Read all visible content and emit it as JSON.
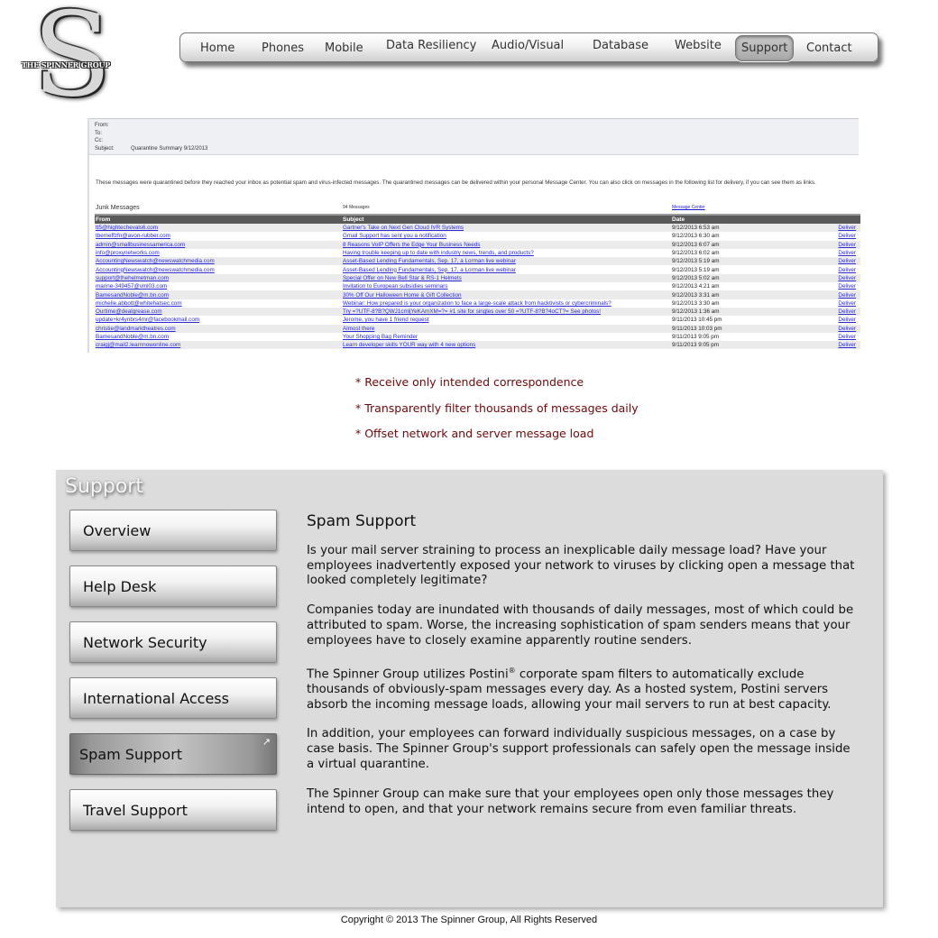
{
  "logo": {
    "letter": "S",
    "brand_text": "THE SPINNER GROUP"
  },
  "nav": {
    "items": [
      {
        "label": "Home",
        "active": false
      },
      {
        "label": "Phones",
        "active": false
      },
      {
        "label": "Mobile",
        "active": false
      },
      {
        "label": "Data Resiliency",
        "active": false
      },
      {
        "label": "Audio/Visual",
        "active": false
      },
      {
        "label": "Database",
        "active": false
      },
      {
        "label": "Website",
        "active": false
      },
      {
        "label": "Support",
        "active": true
      },
      {
        "label": "Contact",
        "active": false
      }
    ]
  },
  "email": {
    "header": {
      "from_label": "From:",
      "from_value": "",
      "to_label": "To:",
      "cc_label": "Cc:",
      "subject_label": "Subject:",
      "subject_value": "Quarantine Summary 9/12/2013"
    },
    "intro": "These messages were quarantined before they reached your inbox as potential spam and virus-infected messages. The quarantined messages can be delivered within your personal Message Center. You can also click on messages in the following list for delivery, if you can see them as links.",
    "junk_title": "Junk Messages",
    "message_count": "94 Messages",
    "message_center_link": "Message Center",
    "columns": [
      "From",
      "Subject",
      "Date",
      ""
    ],
    "deliver_label": "Deliver",
    "rows": [
      {
        "from": "tt5@hightechevals6.com",
        "subject": "Gartner's Take on Next Gen Cloud IVR Systems",
        "date": "9/12/2013 6:53 am"
      },
      {
        "from": "tbemeffzfn@avon-rubber.com",
        "subject": "Gmail Support has sent you a notification",
        "date": "9/12/2013 6:30 am"
      },
      {
        "from": "admin@smallbusinessamerica.com",
        "subject": "8 Reasons VoIP Offers the Edge Your Business Needs",
        "date": "9/12/2013 6:07 am"
      },
      {
        "from": "info@proxynetworks.com",
        "subject": "Having trouble keeping up to date with industry news, trends, and products?",
        "date": "9/12/2013 6:02 am"
      },
      {
        "from": "AccountingNewswatch@newswatchmedia.com",
        "subject": "Asset-Based Lending Fundamentals, Sep. 17, a Lorman live webinar",
        "date": "9/12/2013 5:19 am"
      },
      {
        "from": "AccountingNewswatch@newswatchmedia.com",
        "subject": "Asset-Based Lending Fundamentals, Sep. 17, a Lorman live webinar",
        "date": "9/12/2013 5:19 am"
      },
      {
        "from": "support@thehelmetman.com",
        "subject": "Special Offer on New Bell Star & RS-1 Helmets",
        "date": "9/12/2013 5:02 am"
      },
      {
        "from": "marine-349457@vml03.com",
        "subject": "Invitation to European subsidies seminars",
        "date": "9/12/2013 4:21 am"
      },
      {
        "from": "BarnesandNoble@m.bn.com",
        "subject": "30% Off Our Halloween Home & Gift Collection",
        "date": "9/12/2013 3:31 am"
      },
      {
        "from": "michelle.abbott@whitehatsec.com",
        "subject": "Webinar: How prepared is your organization to face a large-scale attack from hacktivists or cybercriminals?",
        "date": "9/12/2013 3:30 am"
      },
      {
        "from": "Ourtime@dealgrease.com",
        "subject": "Try =?UTF-8?B?QWJ1cmljYeKAmXM=?= #1 site for singles over 50 =?UTF-8?B?4oCT?= See photos!",
        "date": "9/12/2013 1:36 am"
      },
      {
        "from": "update+kr4ynbrs4mr@facebookmail.com",
        "subject": "Jerome, you have 1 friend request",
        "date": "9/11/2013 10:45 pm"
      },
      {
        "from": "christie@landmarktheatres.com",
        "subject": "Almost there",
        "date": "9/11/2013 10:03 pm"
      },
      {
        "from": "BarnesandNoble@m.bn.com",
        "subject": "Your Shopping Bag Reminder",
        "date": "9/11/2013 9:05 pm"
      },
      {
        "from": "craigj@mail2.learnnowonline.com",
        "subject": "Learn developer skills YOUR way with 4 new options",
        "date": "9/11/2013 9:05 pm"
      }
    ]
  },
  "bullets": [
    "* Receive only intended correspondence",
    "* Transparently filter thousands of messages daily",
    "* Offset network and server message load"
  ],
  "support": {
    "title": "Support",
    "menu": [
      {
        "label": "Overview",
        "active": false
      },
      {
        "label": "Help Desk",
        "active": false
      },
      {
        "label": "Network Security",
        "active": false
      },
      {
        "label": "International Access",
        "active": false
      },
      {
        "label": "Spam Support",
        "active": true
      },
      {
        "label": "Travel Support",
        "active": false
      }
    ],
    "heading": "Spam Support",
    "paragraphs": [
      "Is your mail server straining to process an inexplicable daily message load?  Have your employees inadvertently exposed your network to viruses by clicking open a message that looked completely legitimate?",
      "Companies today are inundated with thousands of daily messages, most of which could be attributed to spam.  Worse, the increasing sophistication of spam senders means that your employees have to closely examine apparently routine senders.",
      "In addition, your employees can forward individually suspicious messages, on a case by case basis.  The Spinner Group's support professionals can safely open the message inside a virtual quarantine.",
      "The Spinner Group can make sure that your employees open only those messages they intend to open, and that your network remains secure from even familiar threats."
    ],
    "postini_para": {
      "before": "The Spinner Group utilizes Postini",
      "mark": "®",
      "after": " corporate spam filters to automatically exclude thousands of obviously-spam messages every day.  As a hosted system, Postini servers absorb the incoming message loads, allowing your mail servers to run at best capacity."
    }
  },
  "footer": {
    "copyright": "Copyright © 2013 The Spinner Group, All Rights Reserved"
  }
}
